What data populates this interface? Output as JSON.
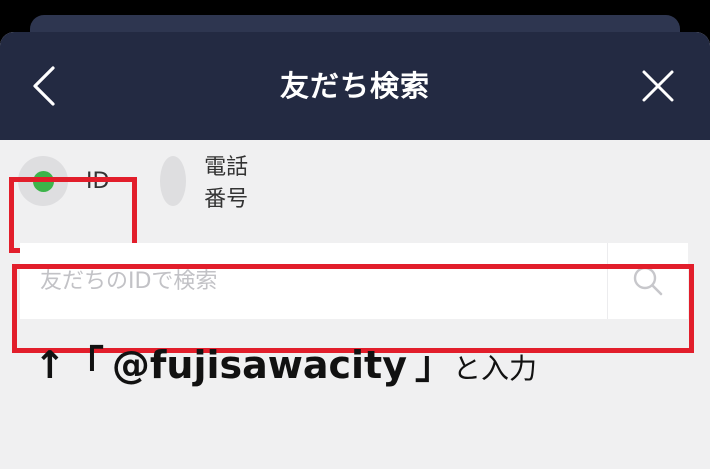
{
  "header": {
    "title": "友だち検索"
  },
  "search_type": {
    "options": [
      {
        "label": "ID",
        "selected": true
      },
      {
        "label": "電話番号",
        "selected": false
      }
    ]
  },
  "search": {
    "placeholder": "友だちのIDで検索",
    "value": ""
  },
  "instruction": {
    "arrow": "↑",
    "open_bracket": "「",
    "handle": "@fujisawacity",
    "close_bracket": "」",
    "suffix": "と入力"
  },
  "colors": {
    "header_bg": "#232a42",
    "selected_dot": "#3db44a",
    "highlight_frame": "#e21e2b"
  },
  "icons": [
    "chevron-left-icon",
    "close-icon",
    "search-icon"
  ]
}
